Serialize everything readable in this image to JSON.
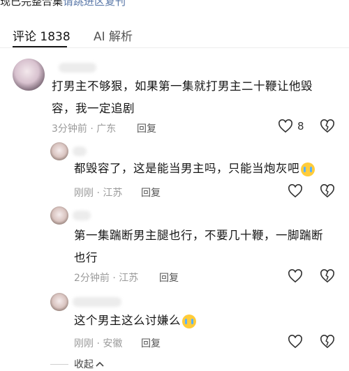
{
  "top_cut": {
    "text": "现已完整合集",
    "link": "请跳进区复刊"
  },
  "tabs": [
    {
      "label": "评论 1838",
      "active": true
    },
    {
      "label": "AI 解析",
      "active": false
    }
  ],
  "comments": [
    {
      "text_line1": "打男主不够狠，如果第一集就打男主二十鞭让他毁",
      "text_line2": "容，我一定追剧",
      "meta": "3分钟前 · 广东",
      "reply_label": "回复",
      "like_count": "8"
    },
    {
      "text": "都毁容了，这是能当男主吗，只能当炮灰吧",
      "meta": "刚刚 · 江苏",
      "reply_label": "回复"
    },
    {
      "text_line1": "第一集踹断男主腿也行，不要几十鞭，一脚踹断",
      "text_line2": "也行",
      "meta": "2分钟前 · 江苏",
      "reply_label": "回复"
    },
    {
      "text": "这个男主这么讨嫌么",
      "meta": "刚刚 · 安徽",
      "reply_label": "回复"
    }
  ],
  "collapse_label": "收起",
  "colors": {
    "accent_text": "#161616",
    "meta": "#9a9a9a",
    "link": "#5a78a8"
  },
  "icons": [
    "heart-icon",
    "dislike-heart-icon",
    "crying-emoji-icon",
    "chevron-up-icon"
  ]
}
